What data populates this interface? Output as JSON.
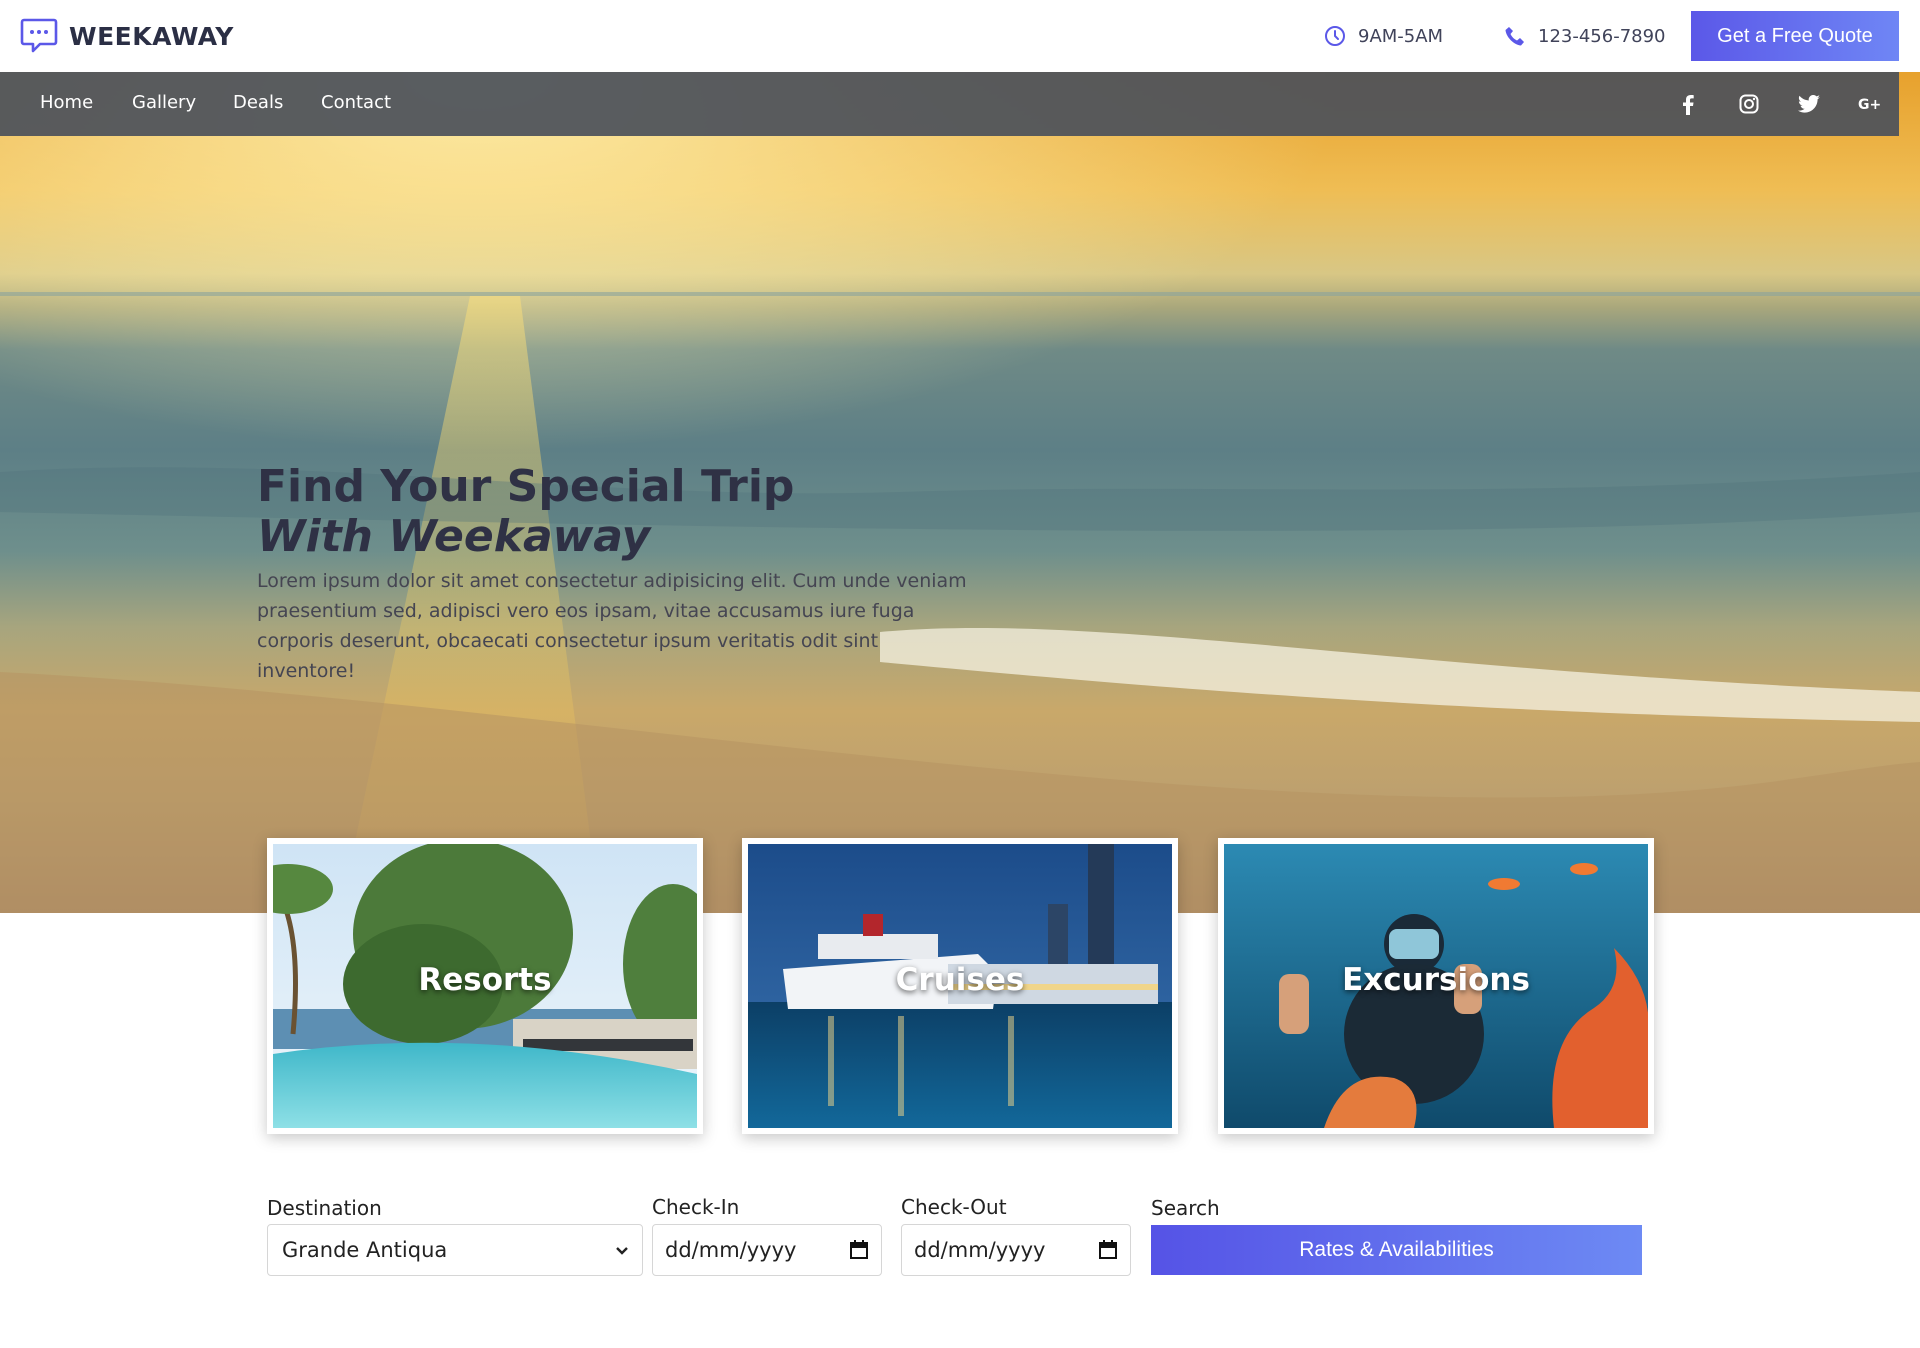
{
  "brand": {
    "name": "WEEKAWAY",
    "logo_icon": "chat-bubble-icon",
    "accent": "#5b58e8"
  },
  "header": {
    "hours": "9AM-5AM",
    "phone": "123-456-7890",
    "quote_button": "Get a Free Quote"
  },
  "nav": {
    "items": [
      {
        "label": "Home"
      },
      {
        "label": "Gallery"
      },
      {
        "label": "Deals"
      },
      {
        "label": "Contact"
      }
    ],
    "social": [
      "facebook-icon",
      "instagram-icon",
      "twitter-icon",
      "google-plus-icon"
    ]
  },
  "hero": {
    "title_line1": "Find Your Special Trip",
    "title_line2": "With Weekaway",
    "description": "Lorem ipsum dolor sit amet consectetur adipisicing elit. Cum unde veniam praesentium sed, adipisci vero eos ipsam, vitae accusamus iure fuga corporis deserunt, obcaecati consectetur ipsum veritatis odit sint inventore!"
  },
  "cards": [
    {
      "label": "Resorts"
    },
    {
      "label": "Cruises"
    },
    {
      "label": "Excursions"
    }
  ],
  "search_form": {
    "destination_label": "Destination",
    "destination_value": "Grande Antiqua",
    "checkin_label": "Check-In",
    "checkin_placeholder": "dd/mm/yyyy",
    "checkout_label": "Check-Out",
    "checkout_placeholder": "dd/mm/yyyy",
    "search_label": "Search",
    "search_button": "Rates & Availabilities"
  }
}
